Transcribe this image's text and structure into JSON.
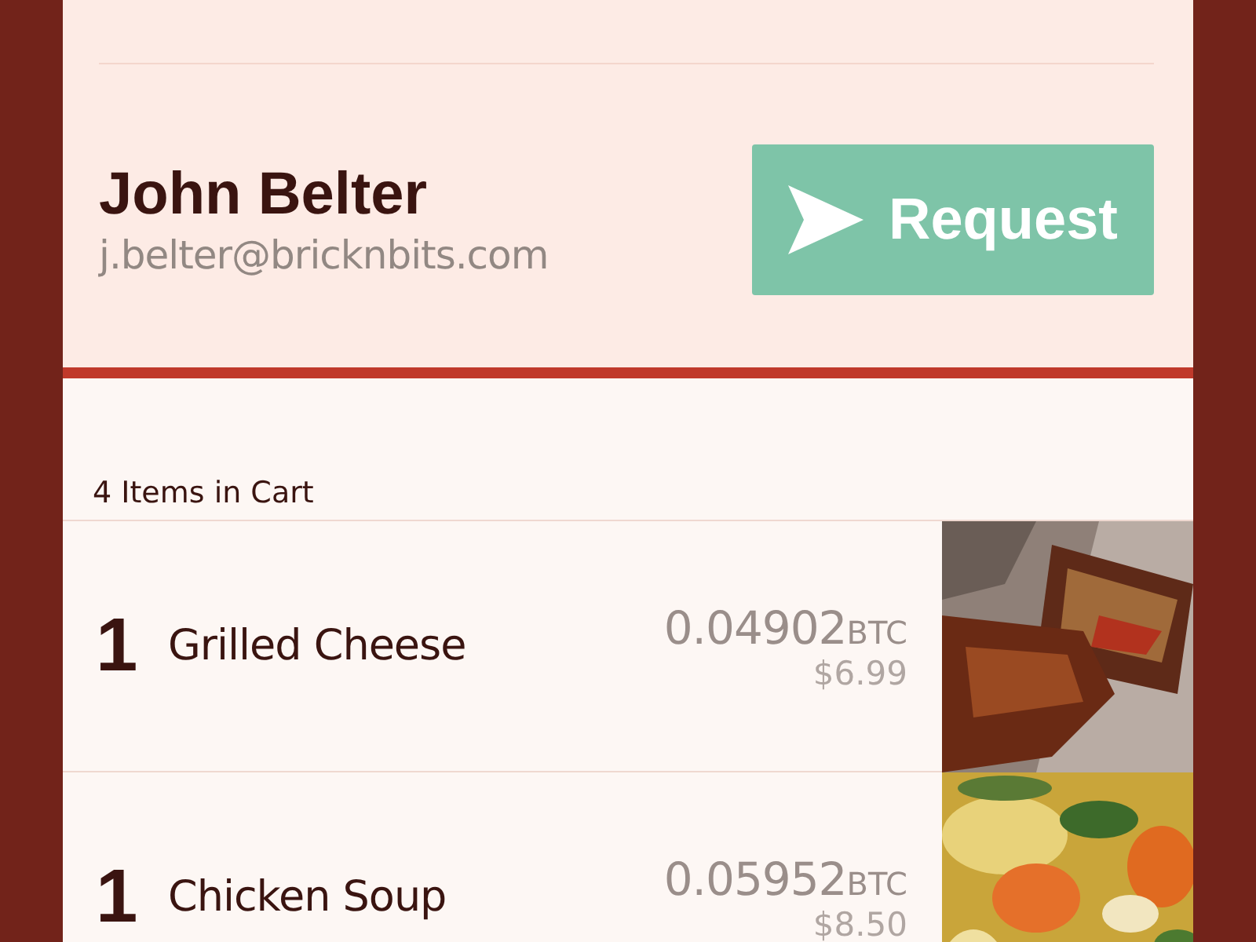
{
  "profile": {
    "name": "John Belter",
    "email": "j.belter@bricknbits.com",
    "button": "Request"
  },
  "cart": {
    "heading": "4 Items in Cart",
    "items": [
      {
        "quantity": "1",
        "name": "Grilled Cheese",
        "btc": "0.04902",
        "unit": "BTC",
        "usd": "$6.99"
      },
      {
        "quantity": "1",
        "name": "Chicken Soup",
        "btc": "0.05952",
        "unit": "BTC",
        "usd": "$8.50"
      }
    ]
  }
}
